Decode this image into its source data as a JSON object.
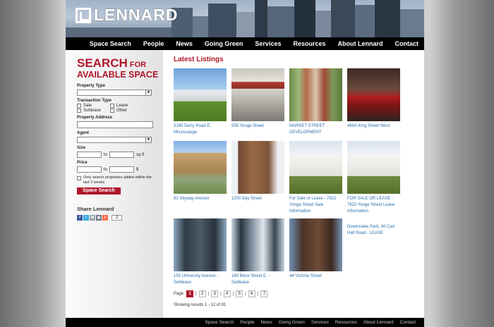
{
  "brand": {
    "name": "LENNARD",
    "accent": "#b0172b",
    "link": "#2a6fab"
  },
  "nav": [
    "Space Search",
    "People",
    "News",
    "Going Green",
    "Services",
    "Resources",
    "About Lennard",
    "Contact"
  ],
  "search": {
    "title_line1_big": "SEARCH",
    "title_line1_small": " FOR",
    "title_line2": "AVAILABLE SPACE",
    "property_type_label": "Property Type",
    "transaction_type_label": "Transaction Type",
    "transaction_options": [
      "Sale",
      "Lease",
      "Sublease",
      "Other"
    ],
    "property_address_label": "Property Address",
    "agent_label": "Agent",
    "size_label": "Size",
    "size_to": "to",
    "size_unit": "sq ft",
    "price_label": "Price",
    "price_to": "to",
    "price_unit": "$",
    "recent_only_label": "Only search properties added within the last 2 weeks",
    "button_label": "Space Search"
  },
  "share": {
    "title": "Share Lennard",
    "count": "2",
    "icons": [
      "facebook-icon",
      "twitter-icon",
      "email-icon",
      "print-icon",
      "addthis-icon"
    ]
  },
  "main": {
    "title": "Latest Listings",
    "listings": [
      {
        "caption": "3160 Derry Road E, Mississauga",
        "photo": "low-office-building"
      },
      {
        "caption": "555 Yonge Street",
        "photo": "street-storefront"
      },
      {
        "caption": "MARKET STREET DEVELOPMENT",
        "photo": "market-street"
      },
      {
        "caption": "469A King Street West",
        "photo": "interior-red-chairs"
      },
      {
        "caption": "93 Skyway Avenue",
        "photo": "suburban-office"
      },
      {
        "caption": "1200 Bay Street",
        "photo": "brown-tower"
      },
      {
        "caption": "For Sale or Lease - 7822 Yonge Street Sale Information",
        "photo": "white-house"
      },
      {
        "caption": "FOR SALE OR LEASE - 7822 Yonge Street Lease Information",
        "photo": "white-house"
      },
      {
        "caption": "155 University Avenue - Sublease",
        "photo": "dark-tower"
      },
      {
        "caption": "160 Bloor Street E. - Sublease",
        "photo": "glass-tower"
      },
      {
        "caption": "44 Victoria Street",
        "photo": "brick-tower"
      },
      {
        "caption": "Downsview Park, 40 Carl Hall Road - LEASE",
        "photo": ""
      }
    ],
    "pager": {
      "label": "Page",
      "pages": [
        "1",
        "2",
        "3",
        "4",
        "5",
        "6",
        "7"
      ],
      "current": "1"
    },
    "results": "Showing results 1 - 12 of 81"
  },
  "footer": [
    "Space Search",
    "People",
    "News",
    "Going Green",
    "Services",
    "Resources",
    "About Lennard",
    "Contact"
  ]
}
